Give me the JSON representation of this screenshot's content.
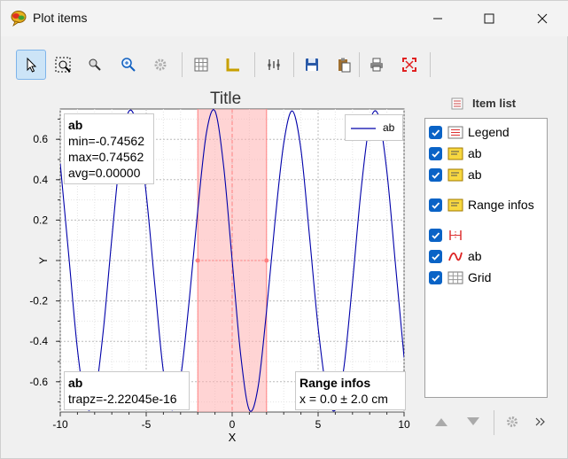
{
  "window": {
    "title": "Plot items",
    "icon": "bubble-icon"
  },
  "toolbar": {
    "buttons": [
      "select-arrow-icon",
      "rect-zoom-icon",
      "zoom-icon",
      "zoom-fit-icon",
      "gear-icon",
      "grid-icon",
      "axes-icon",
      "range-markers-icon",
      "save-icon",
      "paste-icon",
      "print-icon",
      "fullscreen-icon"
    ]
  },
  "plot": {
    "title": "Title",
    "legend_label": "ab",
    "stats": {
      "name": "ab",
      "min": "min=-0.74562",
      "max": "max=0.74562",
      "avg": "avg=0.00000"
    },
    "trapz": {
      "name": "ab",
      "value": "trapz=-2.22045e-16"
    },
    "range": {
      "name": "Range infos",
      "value": "x = 0.0 ± 2.0 cm"
    }
  },
  "chart_data": {
    "type": "line",
    "title": "Title",
    "xlabel": "X",
    "ylabel": "Y",
    "xlim": [
      -10,
      10
    ],
    "ylim": [
      -0.75,
      0.75
    ],
    "x_ticks": [
      -10,
      -5,
      0,
      5,
      10
    ],
    "y_ticks": [
      0.6,
      0.4,
      0.2,
      0,
      -0.2,
      -0.4,
      -0.6
    ],
    "y_tick_labels": [
      "0.6",
      "0.4",
      "0.2",
      "Y",
      "-0.2",
      "-0.4",
      "-0.6"
    ],
    "grid": true,
    "legend": "top-right",
    "series": [
      {
        "name": "ab",
        "color": "#0000aa",
        "x": [
          -10,
          -9.5,
          -9,
          -8.5,
          -8,
          -7.5,
          -7,
          -6.5,
          -6,
          -5.5,
          -5,
          -4.5,
          -4,
          -3.5,
          -3,
          -2.5,
          -2,
          -1.5,
          -1,
          -0.5,
          0,
          0.5,
          1,
          1.5,
          2,
          2.5,
          3,
          3.5,
          4,
          4.5,
          5,
          5.5,
          6,
          6.5,
          7,
          7.5,
          8,
          8.5,
          9,
          9.5,
          10
        ],
        "y": [
          0.48,
          0.02,
          -0.44,
          -0.72,
          -0.68,
          -0.35,
          0.11,
          0.53,
          0.74,
          0.65,
          0.33,
          -0.12,
          -0.55,
          -0.74,
          -0.58,
          -0.2,
          0.25,
          0.63,
          0.74,
          0.47,
          0.0,
          -0.47,
          -0.74,
          -0.63,
          -0.25,
          0.2,
          0.58,
          0.74,
          0.55,
          0.12,
          -0.33,
          -0.65,
          -0.74,
          -0.53,
          -0.11,
          0.35,
          0.68,
          0.72,
          0.44,
          -0.02,
          -0.48
        ]
      }
    ],
    "range_shade": {
      "xmin": -2,
      "xmax": 2,
      "color": "#ffb0b0"
    }
  },
  "item_list": {
    "header": "Item list",
    "items": [
      {
        "label": "Legend",
        "icon": "legend-icon"
      },
      {
        "label": "ab",
        "icon": "label-icon"
      },
      {
        "label": "ab",
        "icon": "label-icon"
      },
      {
        "label": "Range infos",
        "icon": "label-icon"
      },
      {
        "label": "",
        "icon": "xrange-icon"
      },
      {
        "label": "ab",
        "icon": "curve-icon"
      },
      {
        "label": "Grid",
        "icon": "grid-icon"
      }
    ]
  },
  "bottom_buttons": [
    "move-up-icon",
    "move-down-icon",
    "gear-icon",
    "more-icon"
  ]
}
